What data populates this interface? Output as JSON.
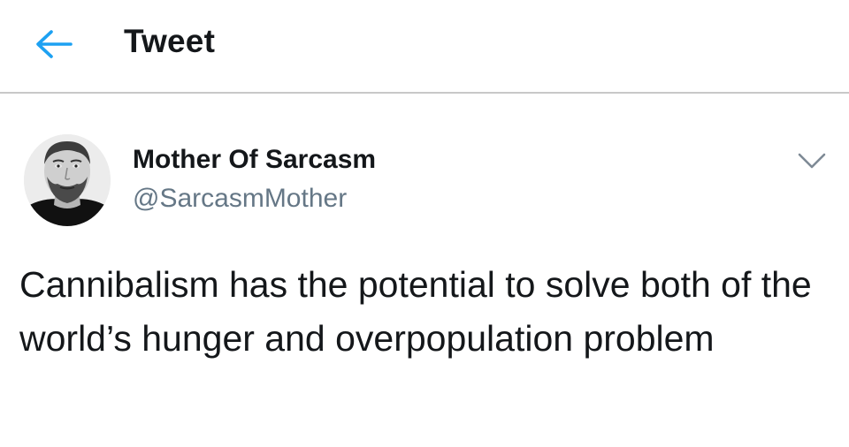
{
  "header": {
    "back_icon": "arrow-left-icon",
    "title": "Tweet",
    "accent_color": "#1da1f2"
  },
  "tweet": {
    "author": {
      "name": "Mother Of Sarcasm",
      "handle": "@SarcasmMother",
      "avatar_icon": "profile-photo"
    },
    "menu_icon": "chevron-down-icon",
    "text": "Cannibalism has the potential to solve both of the world’s hunger and overpopulation problem"
  }
}
